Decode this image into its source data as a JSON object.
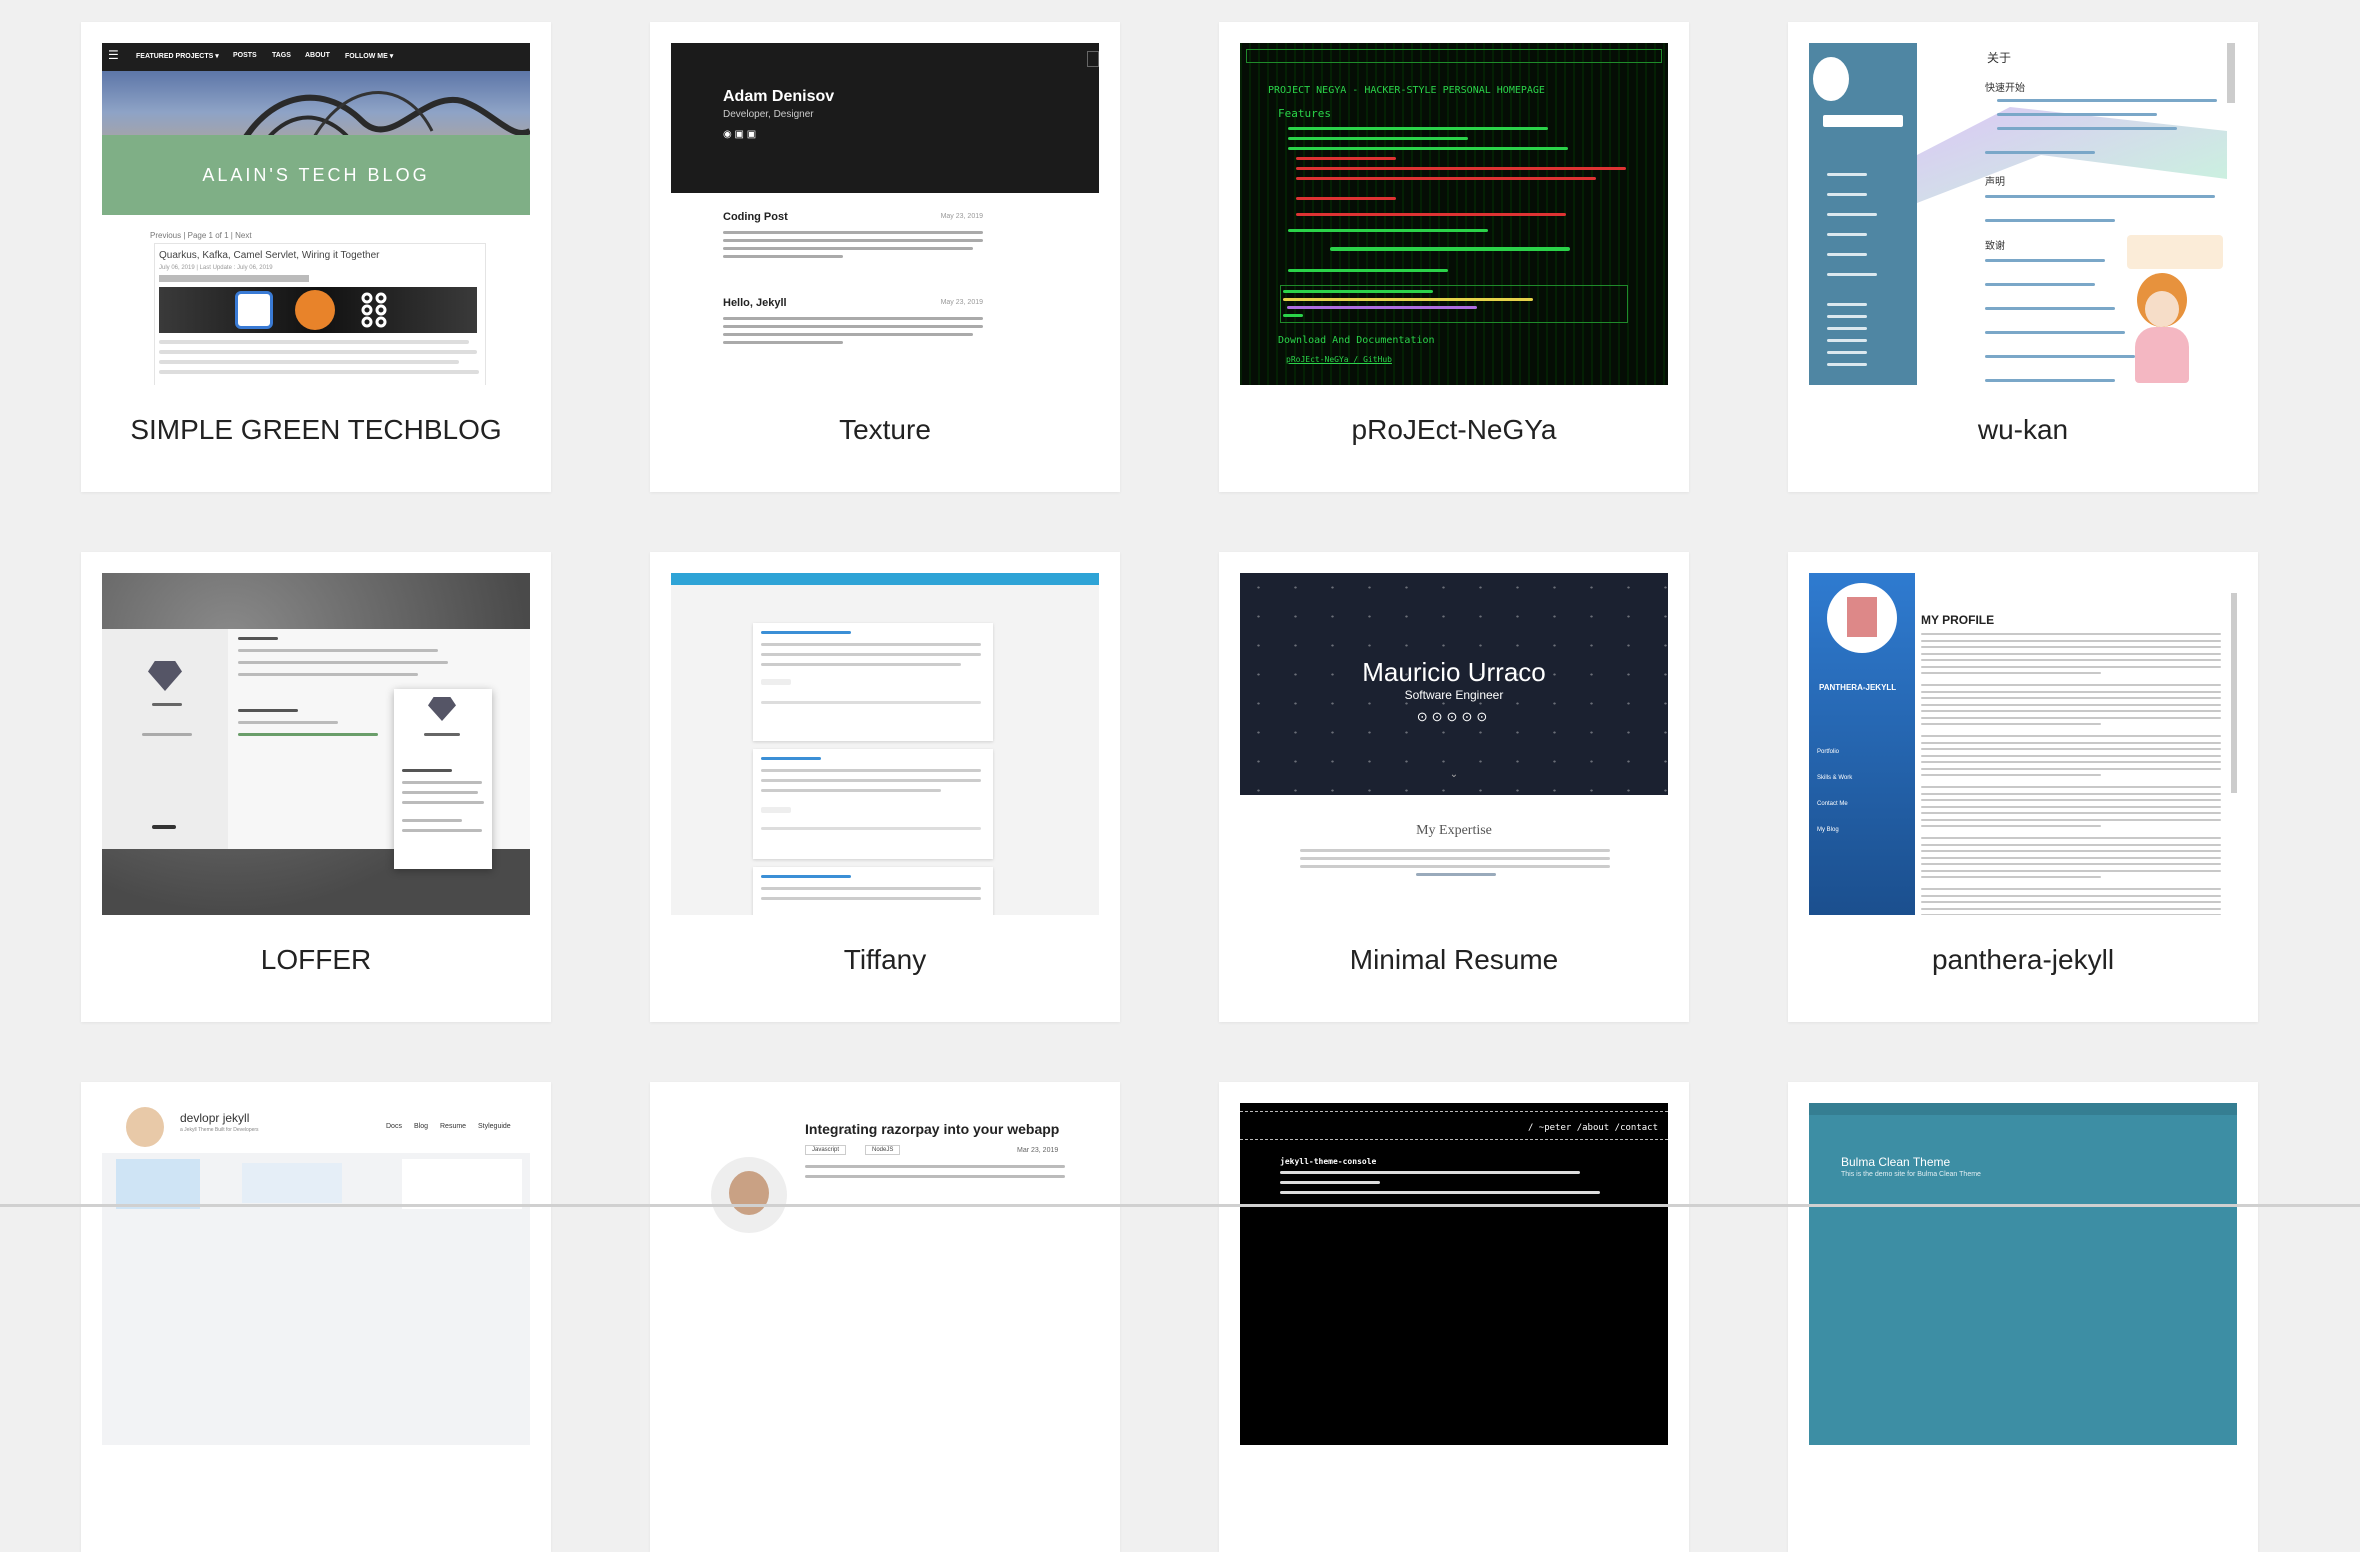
{
  "cards": [
    {
      "name": "SIMPLE GREEN TECHBLOG",
      "preview": {
        "nav": [
          "FEATURED PROJECTS ▾",
          "POSTS",
          "TAGS",
          "ABOUT",
          "FOLLOW ME ▾"
        ],
        "banner": "ALAIN'S TECH BLOG",
        "pager": "Previous | Page 1 of 1 | Next",
        "post_title": "Quarkus, Kafka, Camel Servlet, Wiring it Together",
        "post_meta": "July 06, 2019 | Last Update : July 06, 2019"
      }
    },
    {
      "name": "Texture",
      "preview": {
        "author": "Adam Denisov",
        "role": "Developer, Designer",
        "post1": "Coding Post",
        "date1": "May 23, 2019",
        "post2": "Hello, Jekyll",
        "date2": "May 23, 2019"
      }
    },
    {
      "name": "pRoJEct-NeGYa",
      "preview": {
        "title": "PROJECT NEGYA - HACKER-STYLE PERSONAL HOMEPAGE",
        "features": "Features",
        "download": "Download And Documentation",
        "link": "pRoJEct-NeGYa / GitHub"
      }
    },
    {
      "name": "wu-kan",
      "preview": {
        "about": "关于",
        "quick_start": "快速开始",
        "statement": "声明",
        "thanks": "致谢"
      }
    },
    {
      "name": "LOFFER",
      "preview": {}
    },
    {
      "name": "Tiffany",
      "preview": {}
    },
    {
      "name": "Minimal Resume",
      "preview": {
        "person": "Mauricio Urraco",
        "role": "Software Engineer",
        "section": "My Expertise"
      }
    },
    {
      "name": "panthera-jekyll",
      "preview": {
        "heading": "MY PROFILE",
        "sidebar_title": "PANTHERA-JEKYLL",
        "links": [
          "Portfolio",
          "Skills & Work",
          "Contact Me",
          "My Blog"
        ]
      }
    },
    {
      "name": "",
      "preview": {
        "title": "devlopr jekyll",
        "subtitle": "a Jekyll Theme Built for Developers",
        "nav": [
          "Docs",
          "Blog",
          "Resume",
          "Styleguide"
        ]
      }
    },
    {
      "name": "",
      "preview": {
        "title": "Integrating razorpay into your webapp",
        "tags": [
          "Javascript",
          "NodeJS"
        ],
        "date": "Mar 23, 2019"
      }
    },
    {
      "name": "",
      "preview": {
        "path": "/ ~peter /about /contact",
        "title": "jekyll-theme-console"
      }
    },
    {
      "name": "",
      "preview": {
        "title": "Bulma Clean Theme",
        "subtitle": "This is the demo site for Bulma Clean Theme"
      }
    }
  ]
}
